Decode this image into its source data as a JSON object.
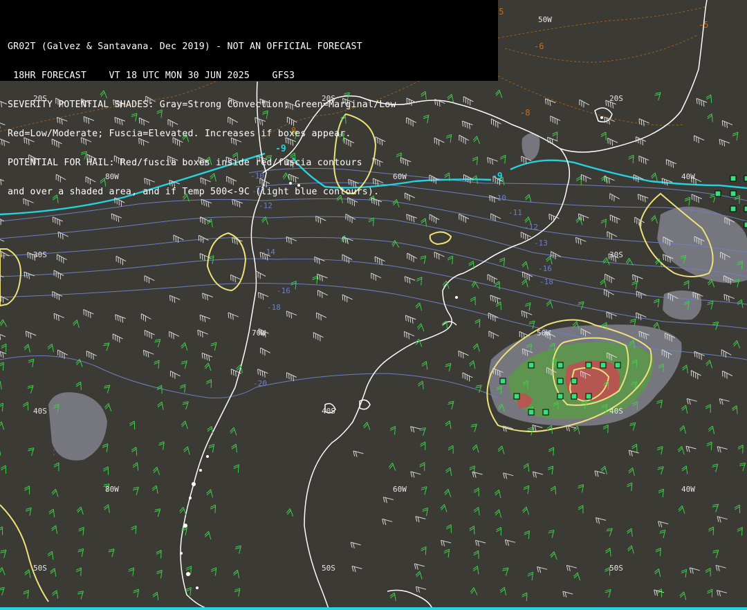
{
  "header": {
    "lines": [
      "GR02T (Galvez & Santavana. Dec 2019) - NOT AN OFFICIAL FORECAST",
      " 18HR FORECAST    VT 18 UTC MON 30 JUN 2025    GFS3",
      "SEVERITY POTENTIAL SHADES: Gray=Strong Convection; Green=Marginal/Low",
      "Red=Low/Moderate; Fuscia=Elevated. Increases if boxes appear.",
      "POTENTIAL FOR HAIL: Red/fuscia boxes inside red/fuscia contours",
      "and over a shaded area, and if Temp 500<-9C (light blue contours)."
    ]
  },
  "grid_labels": {
    "lat20_a": "20S",
    "lat20_b": "20S",
    "lat20_c": "20S",
    "lat30_a": "30S",
    "lat30_b": "30S",
    "lat40_a": "40S",
    "lat40_b": "40S",
    "lat40_c": "40S",
    "lat50_a": "50S",
    "lat50_b": "50S",
    "lat50_c": "50S",
    "lon80_a": "80W",
    "lon80_b": "80W",
    "lon70_a": "70W",
    "lon60_a": "60W",
    "lon60_b": "60W",
    "lon50_a": "50W",
    "lon50_b": "50W",
    "lon40_a": "40W",
    "lon40_b": "40W"
  },
  "temp_labels": {
    "t10a": "-10",
    "t11a": "-11",
    "t12a": "-12",
    "t10b": "-10",
    "t11b": "-11",
    "t12b": "-12",
    "t13": "-13",
    "t14": "-14",
    "t16": "-16",
    "t18": "-18",
    "t20": "-20",
    "t16b": "-16",
    "t18b": "-18"
  },
  "freezing_labels": {
    "c9a": "-9",
    "c9b": "-9"
  },
  "orange_labels": {
    "o5a": "-5",
    "o5b": "-5",
    "o6": "-6",
    "o8a": "8",
    "o8b": "-8",
    "o7": "7"
  },
  "colors": {
    "background": "#3b3a35",
    "header_bg": "#000000",
    "coastline": "#ffffff",
    "cold_contour": "#25d3e0",
    "temp_contour": "#6f7fc0",
    "severity_contour": "#f0e27a",
    "gray_shade": "#7d7d86",
    "green_shade": "#5c9a48",
    "red_shade": "#c05050",
    "wind_green": "#3fd14a",
    "wind_white": "#d8d8d8",
    "hail_box": "#37e07a"
  }
}
